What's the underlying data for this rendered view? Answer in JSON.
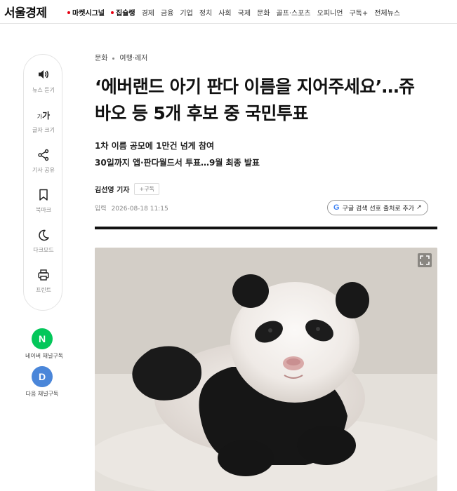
{
  "site": {
    "logo": "서울경제"
  },
  "nav": {
    "hot_items": [
      "마켓시그널",
      "집슐랭"
    ],
    "items": [
      "경제",
      "금융",
      "기업",
      "정치",
      "사회",
      "국제",
      "문화",
      "골프·스포츠",
      "오피니언",
      "구독+",
      "전체뉴스"
    ],
    "accent_dot_color": "#e60012"
  },
  "tools": [
    {
      "icon": "speaker-icon",
      "label": "뉴스 듣기"
    },
    {
      "icon": "font-size-icon",
      "icon_text_small": "가",
      "icon_text": "가",
      "label": "글자 크기"
    },
    {
      "icon": "share-icon",
      "label": "기사 공유"
    },
    {
      "icon": "bookmark-icon",
      "label": "북마크"
    },
    {
      "icon": "moon-icon",
      "label": "다크모드"
    },
    {
      "icon": "printer-icon",
      "label": "프린트"
    }
  ],
  "subscribe": {
    "naver": {
      "letter": "N",
      "label": "네이버 채널구독",
      "color": "#03c75a"
    },
    "daum": {
      "letter": "D",
      "label": "다음 채널구독",
      "color": "#4a86d9"
    }
  },
  "article": {
    "section": "문화",
    "subsection": "여행·레저",
    "headline_line1": "‘에버랜드 아기 판다 이름을 지어주세요’…쥬",
    "headline_line2": "바오 등 5개 후보 중 국민투표",
    "subhead_line1": "1차 이름 공모에 1만건 넘게 참여",
    "subhead_line2": "30일까지 앱·판다월드서 투표…9월 최종 발표",
    "author": "김선영 기자",
    "follow_label": "+구독",
    "date_label": "입력",
    "date": "2026-08-18 11:15",
    "google_pref_label": "구글 검색 선호 출처로 추가",
    "google_letter": "G",
    "google_arrow": "↗"
  }
}
